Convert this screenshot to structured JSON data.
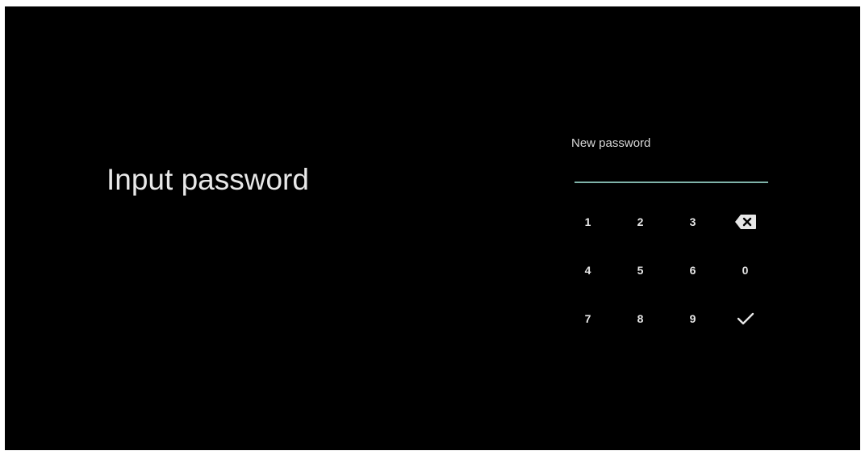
{
  "title": "Input password",
  "field": {
    "label": "New password",
    "value": "",
    "underline_color": "#7fb3a9"
  },
  "keypad": {
    "rows": [
      [
        "1",
        "2",
        "3",
        "backspace-icon"
      ],
      [
        "4",
        "5",
        "6",
        "0"
      ],
      [
        "7",
        "8",
        "9",
        "checkmark-icon"
      ]
    ]
  },
  "colors": {
    "background": "#000000",
    "text": "#e8e8e8",
    "accent": "#7fb3a9"
  }
}
